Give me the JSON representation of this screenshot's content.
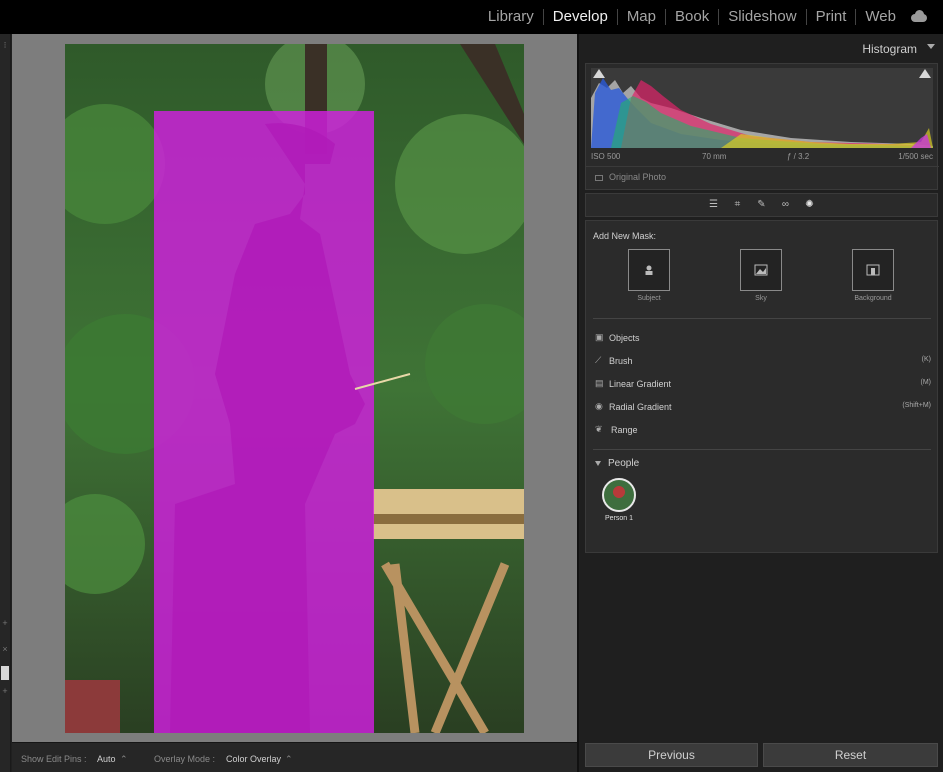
{
  "modules": [
    "Library",
    "Develop",
    "Map",
    "Book",
    "Slideshow",
    "Print",
    "Web"
  ],
  "active_module": "Develop",
  "histogram": {
    "title": "Histogram",
    "iso": "ISO 500",
    "focal_length": "70 mm",
    "aperture": "ƒ / 3.2",
    "shutter": "1/500 sec",
    "original_photo": "Original Photo"
  },
  "masking": {
    "add_new_mask": "Add New Mask:",
    "tiles": [
      "Subject",
      "Sky",
      "Background"
    ],
    "items": [
      {
        "label": "Objects",
        "shortcut": "",
        "icon": "objects-icon"
      },
      {
        "label": "Brush",
        "shortcut": "(K)",
        "icon": "brush-icon"
      },
      {
        "label": "Linear Gradient",
        "shortcut": "(M)",
        "icon": "linear-gradient-icon"
      },
      {
        "label": "Radial Gradient",
        "shortcut": "(Shift+M)",
        "icon": "radial-gradient-icon"
      },
      {
        "label": "Range",
        "shortcut": "",
        "icon": "range-icon"
      }
    ],
    "people_header": "People",
    "person_label": "Person 1"
  },
  "buttons": {
    "previous": "Previous",
    "reset": "Reset"
  },
  "toolbar": {
    "show_edit_pins_label": "Show Edit Pins :",
    "show_edit_pins_value": "Auto",
    "overlay_mode_label": "Overlay Mode :",
    "overlay_mode_value": "Color Overlay"
  },
  "colors": {
    "overlay": "#d21ee0",
    "background": "#202020",
    "canvas": "#7d7d7d"
  }
}
